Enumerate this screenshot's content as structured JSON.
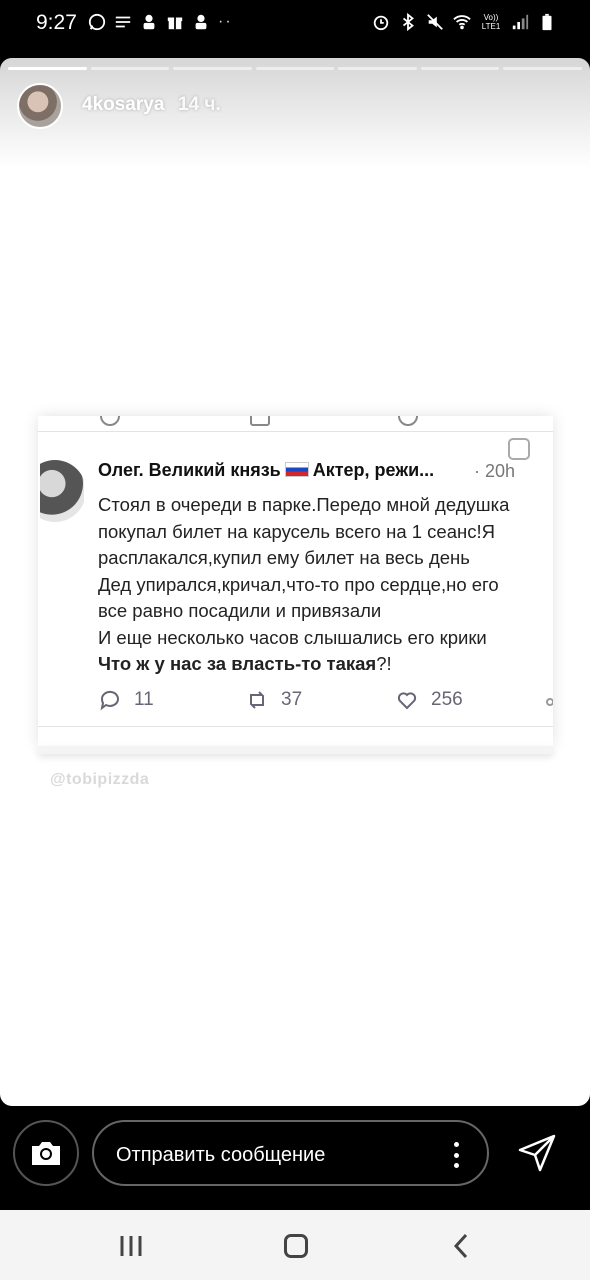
{
  "status_bar": {
    "time": "9:27",
    "left_icons": [
      "whatsapp-icon",
      "messages-icon",
      "app-icon",
      "gift-icon",
      "app-icon"
    ],
    "more_notifications": "··",
    "right_icons": [
      "alarm-icon",
      "bluetooth-icon",
      "mute-icon",
      "wifi-icon",
      "volte-icon",
      "signal-icon",
      "battery-icon"
    ],
    "volte_label": "Vo)) LTE1"
  },
  "story": {
    "username": "4kosarya",
    "posted_ago": "14 ч.",
    "progress_segments": 7,
    "progress_current": 1,
    "tweet": {
      "author": "Олег. Великий князь",
      "author_suffix": "Актер, режи...",
      "time": "· 20h",
      "lines": [
        "Стоял в очереди в парке.Передо мной дедушка",
        "покупал билет на карусель всего на 1 сеанс!Я",
        "расплакался,купил ему билет на весь день",
        "Дед упирался,кричал,что-то про сердце,но его",
        "все равно посадили и привязали",
        "И еще несколько часов слышались его крики"
      ],
      "last_bold": "Что ж у нас за власть-то такая",
      "last_tail": "?!",
      "replies": "11",
      "retweets": "37",
      "likes": "256"
    },
    "watermark": "@tobipizzda"
  },
  "reply_bar": {
    "placeholder": "Отправить сообщение"
  },
  "colors": {
    "background": "#000000",
    "story_bg": "#ffffff",
    "nav_bg": "#f4f4f4"
  }
}
